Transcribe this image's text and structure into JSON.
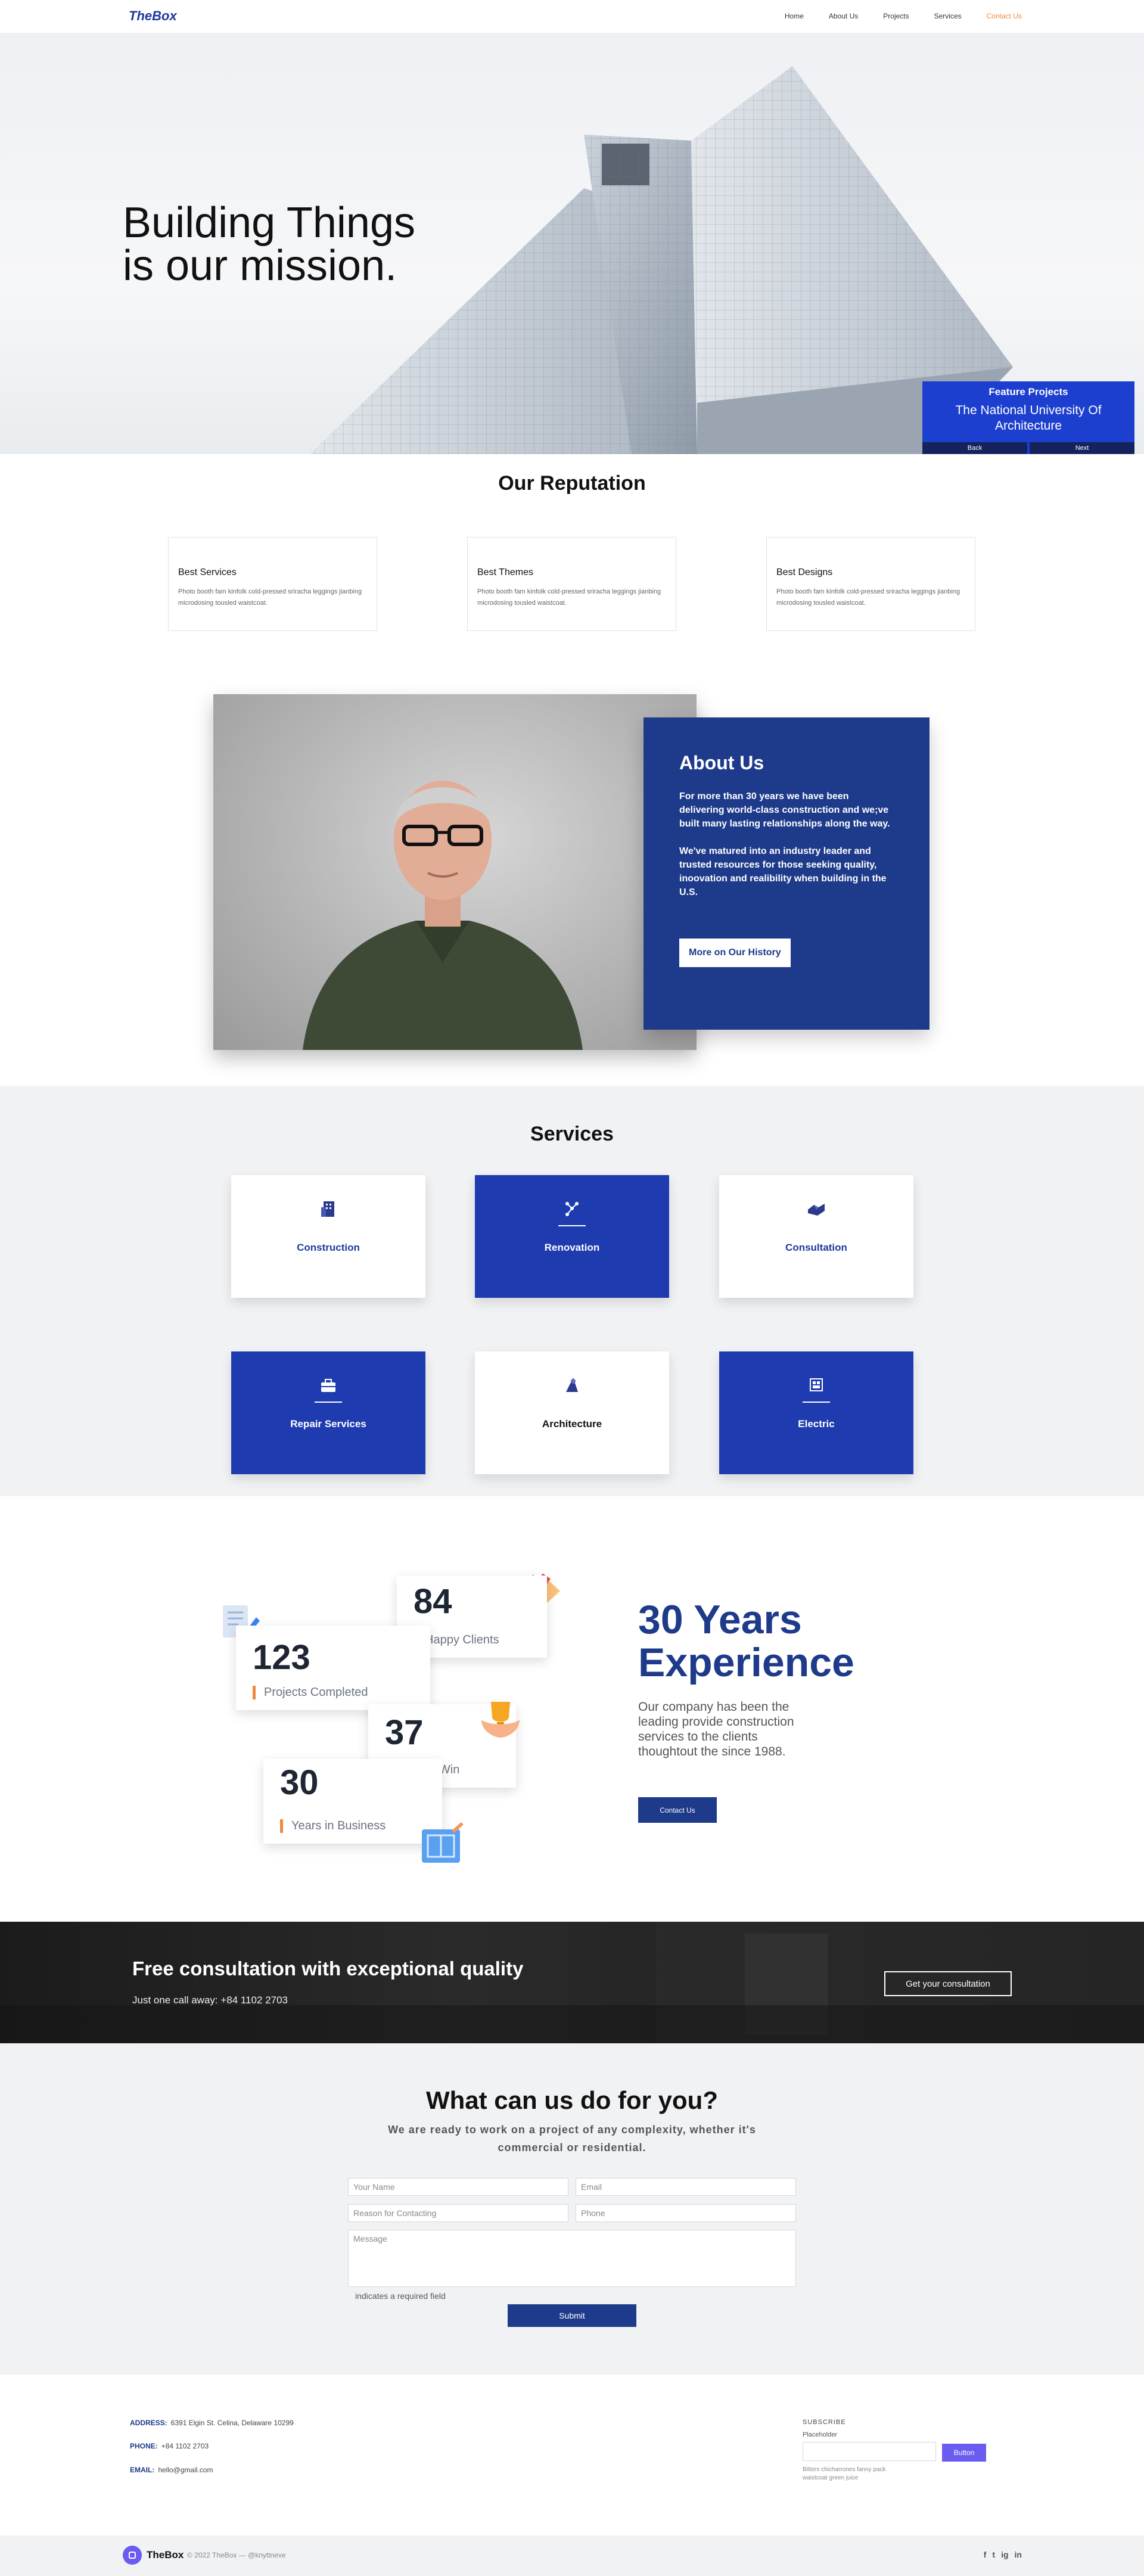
{
  "nav": {
    "logo": "TheBox",
    "links": [
      "Home",
      "About Us",
      "Projects",
      "Services",
      "Contact Us"
    ]
  },
  "hero": {
    "title": "Building Things\nis our mission.",
    "feature": {
      "label": "Feature Projects",
      "name": "The National University Of Architecture",
      "back": "Back",
      "next": "Next"
    }
  },
  "reputation": {
    "title": "Our Reputation",
    "cards": [
      {
        "title": "Best Services",
        "text": "Photo booth fam kinfolk cold-pressed sriracha leggings jianbing microdosing tousled waistcoat."
      },
      {
        "title": "Best Themes",
        "text": "Photo booth fam kinfolk cold-pressed sriracha leggings jianbing microdosing tousled waistcoat."
      },
      {
        "title": "Best Designs",
        "text": "Photo booth fam kinfolk cold-pressed sriracha leggings jianbing microdosing tousled waistcoat."
      }
    ]
  },
  "about": {
    "title": "About Us",
    "p1": "For more than 30 years we have been delivering world-class construction and we;ve built many lasting relationships along the way.",
    "p2": "We've matured into an industry leader and trusted resources for those seeking quality, inoovation and realibility when building in the U.S.",
    "button": "More on Our History"
  },
  "services": {
    "title": "Services",
    "items": [
      {
        "label": "Construction",
        "icon": "building-icon"
      },
      {
        "label": "Renovation",
        "icon": "nodes-icon"
      },
      {
        "label": "Consultation",
        "icon": "handshake-icon"
      },
      {
        "label": "Repair Services",
        "icon": "toolbox-icon"
      },
      {
        "label": "Architecture",
        "icon": "architect-icon"
      },
      {
        "label": "Electric",
        "icon": "electric-panel-icon"
      }
    ]
  },
  "experience": {
    "stats": [
      {
        "num": "84",
        "label": "Happy Clients"
      },
      {
        "num": "123",
        "label": "Projects Completed"
      },
      {
        "num": "37",
        "label": "Awards Win"
      },
      {
        "num": "30",
        "label": "Years in Business"
      }
    ],
    "title": "30 Years\nExperience",
    "text": "Our company has been the leading provide construction services to the clients thoughtout the since 1988.",
    "button": "Contact Us"
  },
  "consult": {
    "title": "Free consultation with exceptional quality",
    "sub": "Just one call away: +84 1102 2703",
    "button": "Get your consultation"
  },
  "contact": {
    "title": "What can us do for you?",
    "lead": "We are ready to work on a project of any complexity, whether it's commercial or residential.",
    "ph_name": "Your Name",
    "ph_email": "Email",
    "ph_reason": "Reason for Contacting",
    "ph_phone": "Phone",
    "ph_message": "Message",
    "required": "indicates a required field",
    "submit": "Submit"
  },
  "footer": {
    "address_label": "ADDRESS:",
    "address": "6391 Elgin St. Celina, Delaware 10299",
    "phone_label": "PHONE:",
    "phone": "+84 1102 2703",
    "email_label": "EMAIL:",
    "email": "hello@gmail.com",
    "subscribe_title": "SUBSCRIBE",
    "subscribe_label": "Placeholder",
    "subscribe_button": "Button",
    "subscribe_note": "Bitters chicharrones fanny pack waistcoat green juice",
    "brand": "TheBox",
    "copyright": "© 2022 TheBox — @knyttneve",
    "social": [
      "f",
      "t",
      "ig",
      "in"
    ]
  },
  "colors": {
    "brand": "#1e3a8a",
    "accent": "#f0883a",
    "feature_blue": "#1d3fcf",
    "subscribe": "#6a5cf0"
  }
}
